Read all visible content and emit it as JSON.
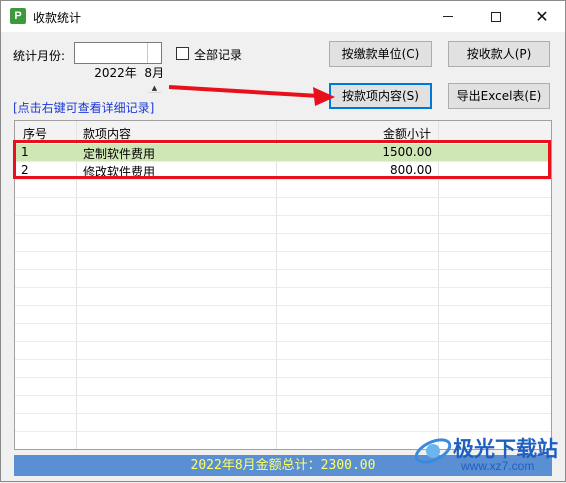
{
  "window": {
    "title": "收款统计",
    "app_icon_letter": "P",
    "controls": {
      "minimize": "—",
      "maximize": "☐",
      "close": "✕"
    }
  },
  "filters": {
    "month_label": "统计月份:",
    "month_value": "2022年  8月",
    "all_records_label": "全部记录",
    "all_records_checked": false
  },
  "buttons": {
    "by_unit": "按缴款单位(C)",
    "by_payer": "按收款人(P)",
    "by_content": "按款项内容(S)",
    "export_excel": "导出Excel表(E)"
  },
  "hint": "[点击右键可查看详细记录]",
  "table": {
    "columns": [
      "序号",
      "款项内容",
      "金额小计"
    ],
    "rows": [
      {
        "index": "1",
        "content": "定制软件费用",
        "amount": "1500.00",
        "selected": true
      },
      {
        "index": "2",
        "content": "修改软件费用",
        "amount": "800.00",
        "selected": false
      }
    ]
  },
  "footer": "2022年8月金额总计：2300.00",
  "watermark": {
    "text": "极光下载站",
    "url": "www.xz7.com"
  },
  "colors": {
    "selected_row": "#cfe7b4",
    "annotation_red": "#e8101b",
    "footer_bg": "#5b8fd4",
    "footer_text": "#ffff66",
    "hint_text": "#1d3ad6"
  }
}
